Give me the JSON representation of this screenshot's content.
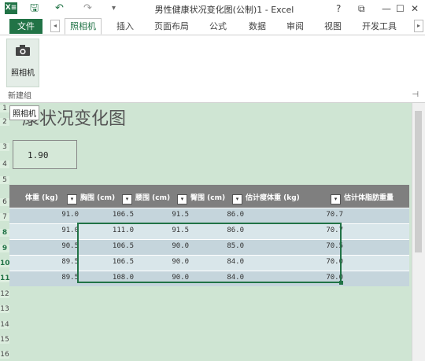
{
  "window": {
    "title": "男性健康状况变化图(公制)1 - Excel",
    "help": "?",
    "restore_ribbon": "⧉",
    "minimize": "—",
    "maximize": "☐",
    "close": "✕"
  },
  "qat": {
    "logo": "X≡",
    "save": "🖫",
    "undo": "↶",
    "redo": "↷",
    "customize": "▾"
  },
  "tabs": [
    {
      "label": "文件"
    },
    {
      "label": "照相机"
    },
    {
      "label": "插入"
    },
    {
      "label": "页面布局"
    },
    {
      "label": "公式"
    },
    {
      "label": "数据"
    },
    {
      "label": "审阅"
    },
    {
      "label": "视图"
    },
    {
      "label": "开发工具"
    }
  ],
  "ribbon": {
    "camera_button": "照相机",
    "group_label": "新建组",
    "tooltip": "照相机"
  },
  "sheet": {
    "title": "康状况变化图",
    "value": "1.90",
    "row_numbers": [
      "1",
      "2",
      "3",
      "4",
      "5",
      "6",
      "7",
      "8",
      "9",
      "10",
      "11",
      "12",
      "13",
      "14",
      "15",
      "16"
    ],
    "headers": [
      "体重 (kg)",
      "胸围 (cm)",
      "腰围 (cm)",
      "臀围 (cm)",
      "估计瘦体重 (kg)",
      "估计体脂肪重量"
    ],
    "rows": [
      [
        "91.0",
        "106.5",
        "91.5",
        "86.0",
        "70.7"
      ],
      [
        "91.0",
        "111.0",
        "91.5",
        "86.0",
        "70.7"
      ],
      [
        "90.5",
        "106.5",
        "90.0",
        "85.0",
        "70.5"
      ],
      [
        "89.5",
        "106.5",
        "90.0",
        "84.0",
        "70.0"
      ],
      [
        "89.5",
        "108.0",
        "90.0",
        "84.0",
        "70.0"
      ]
    ]
  },
  "colors": {
    "accent": "#217346",
    "header_bg": "#7f7f7f",
    "row_a": "#c5d5dc",
    "row_b": "#d9e6ea",
    "sheet_bg": "#cfe5d3"
  }
}
